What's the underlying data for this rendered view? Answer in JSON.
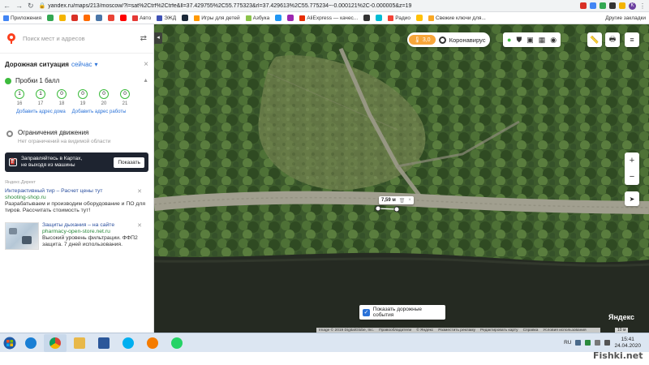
{
  "browser": {
    "url": "yandex.ru/maps/213/moscow/?l=sat%2Ctrf%2Ctrfe&ll=37.429755%2C55.775323&rl=37.429613%2C55.775234~-0.000121%2C-0.000005&z=19",
    "profile_initial": "K",
    "bookmarks": [
      "Приложения",
      "Авто",
      "ЭЖД",
      "Игры для детей",
      "Азбука",
      "AliExpress — качес...",
      "Радио",
      "Свежие ключи для..."
    ],
    "other_bookmarks": "Другие закладки"
  },
  "search": {
    "placeholder": "Поиск мест и адресов"
  },
  "traffic": {
    "title": "Дорожная ситуация",
    "now": "сейчас",
    "level_label": "Пробки 1 балл",
    "forecast": [
      {
        "value": "1",
        "hour": "16"
      },
      {
        "value": "1",
        "hour": "17"
      },
      {
        "value": "0",
        "hour": "18"
      },
      {
        "value": "0",
        "hour": "19"
      },
      {
        "value": "0",
        "hour": "20"
      },
      {
        "value": "0",
        "hour": "21"
      }
    ],
    "add_home": "Добавить адрес дома",
    "add_work": "Добавить адрес работы"
  },
  "restrictions": {
    "title": "Ограничения движения",
    "subtitle": "Нет ограничений на видимой области"
  },
  "promo": {
    "line1": "Заправляйтесь в Картах,",
    "line2": "не выходя из машины",
    "button": "Показать"
  },
  "ads": {
    "label": "Яндекс.Директ",
    "items": [
      {
        "title": "Интерактивный тир – Расчет цены тут",
        "url": "shooting-shop.ru",
        "text": "Разрабатываем и производим оборудование и ПО для тиров. Рассчитать стоимость тут!"
      },
      {
        "title": "Защиты дыхания – на сайте",
        "url": "pharmacy-open-store.net.ru",
        "text": "Высокий уровень фильтрации. ФФП2 защита. 7 дней использования."
      }
    ]
  },
  "map_controls": {
    "temperature": "3,0",
    "covid": "Коронавирус",
    "show_events": "Показать дорожные события",
    "ruler_distance": "7,59 м",
    "logo": "Яндекс",
    "scale": "10 м"
  },
  "footer": {
    "copyright": "Image © 2019 DigitalGlobe, Inc.",
    "links": [
      "Правообладатели",
      "© Яндекс",
      "Разместить рекламу",
      "Редактировать карту",
      "Справка",
      "Условия использования"
    ]
  },
  "taskbar": {
    "lang": "RU",
    "time": "15:41",
    "date": "24.04.2020"
  },
  "watermark": "Fishki.net",
  "colors": {
    "accent": "#2a72d8",
    "traffic_green": "#3dbb3d",
    "yandex_red": "#fc3f1d",
    "temp_orange": "#f7a63a"
  }
}
